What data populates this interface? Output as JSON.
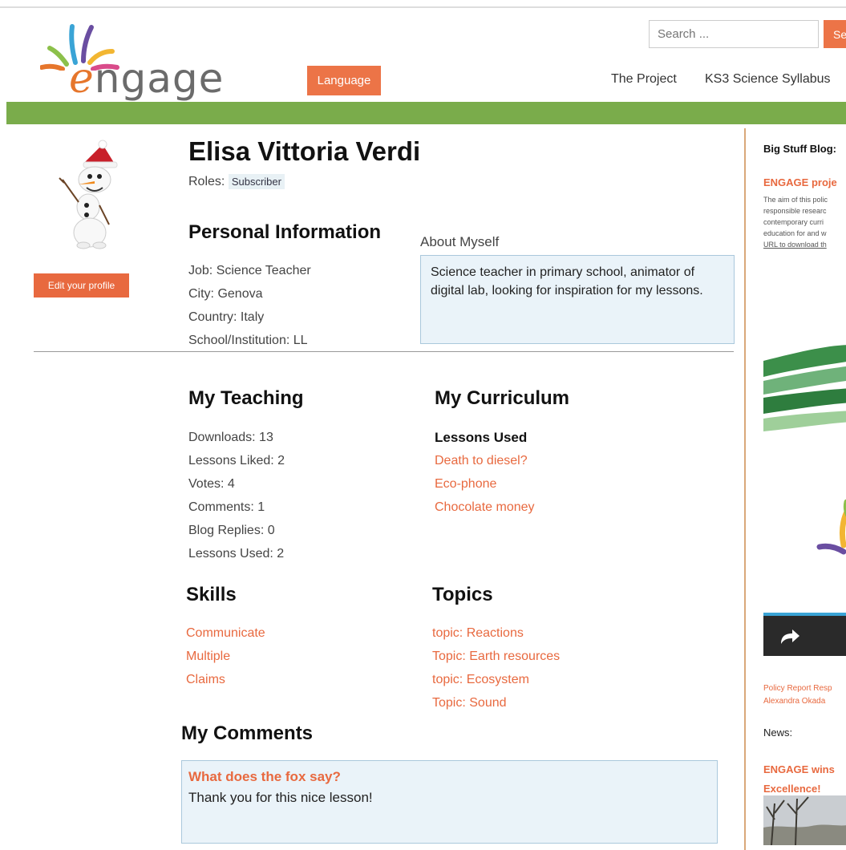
{
  "header": {
    "logo_text_e": "e",
    "logo_text_rest": "ngage",
    "language_label": "Language",
    "search_placeholder": "Search ...",
    "search_button_label": "Se",
    "nav": [
      "The Project",
      "KS3 Science Syllabus"
    ]
  },
  "profile": {
    "name": "Elisa Vittoria Verdi",
    "roles_label": "Roles:",
    "role": "Subscriber",
    "edit_label": "Edit your profile",
    "personal_heading": "Personal Information",
    "job": "Job: Science Teacher",
    "city": "City: Genova",
    "country": "Country: Italy",
    "school": "School/Institution: LL",
    "about_label": "About Myself",
    "about_text": "Science teacher in primary school, animator of digital lab, looking for inspiration for my lessons."
  },
  "teaching": {
    "heading": "My Teaching",
    "stats": [
      "Downloads: 13",
      "Lessons Liked: 2",
      "Votes: 4",
      "Comments: 1",
      "Blog Replies: 0",
      "Lessons Used: 2"
    ]
  },
  "curriculum": {
    "heading": "My Curriculum",
    "lessons_label": "Lessons Used",
    "lessons": [
      "Death to diesel?",
      "Eco-phone",
      "Chocolate money"
    ]
  },
  "skills": {
    "heading": "Skills",
    "items": [
      "Communicate",
      "Multiple",
      "Claims"
    ]
  },
  "topics": {
    "heading": "Topics",
    "items": [
      "topic: Reactions",
      "Topic: Earth resources",
      "topic: Ecosystem",
      "Topic: Sound"
    ]
  },
  "comments": {
    "heading": "My Comments",
    "title": "What does the fox say?",
    "text": "Thank you for this nice lesson!"
  },
  "sidebar": {
    "blog_heading": "Big Stuff Blog:",
    "blog_link": "ENGAGE proje",
    "blog_excerpt": [
      "The aim of this polic",
      "responsible researc",
      "contemporary curri",
      "education for and w",
      "URL to download th"
    ],
    "policy_line1": "Policy Report Resp",
    "policy_line2": "Alexandra Okada",
    "news_heading": "News:",
    "news_link1": "ENGAGE wins",
    "news_link2": "Excellence!"
  },
  "colors": {
    "accent": "#e8693f",
    "green_bar": "#7aac4b",
    "box_bg": "#eaf3f9"
  }
}
